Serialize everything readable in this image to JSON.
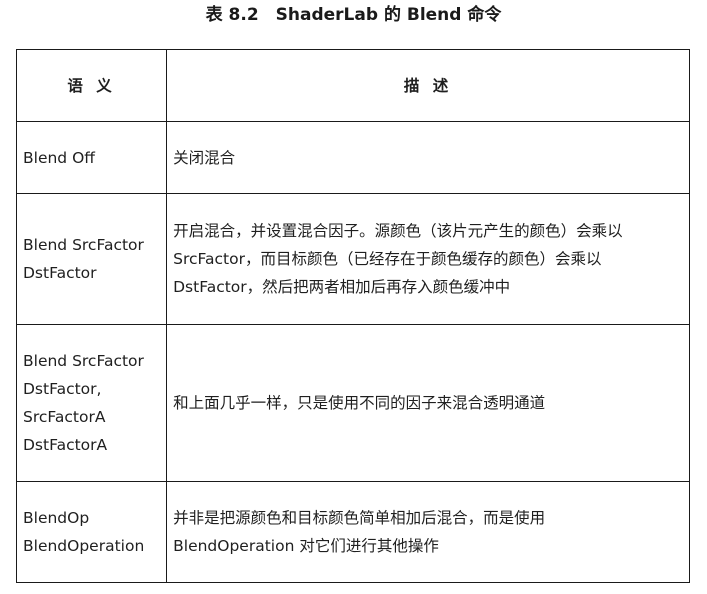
{
  "caption": "表 8.2　ShaderLab 的 Blend 命令",
  "table": {
    "headers": [
      "语 义",
      "描 述"
    ],
    "rows": [
      {
        "semantic": [
          "Blend Off"
        ],
        "description": [
          "关闭混合"
        ]
      },
      {
        "semantic": [
          "Blend SrcFactor",
          "DstFactor"
        ],
        "description": [
          "开启混合，并设置混合因子。源颜色（该片元产生的颜色）会乘以",
          "SrcFactor，而目标颜色（已经存在于颜色缓存的颜色）会乘以",
          "DstFactor，然后把两者相加后再存入颜色缓冲中"
        ]
      },
      {
        "semantic": [
          "Blend SrcFactor",
          "DstFactor,",
          "SrcFactorA",
          "DstFactorA"
        ],
        "description": [
          "和上面几乎一样，只是使用不同的因子来混合透明通道"
        ]
      },
      {
        "semantic": [
          "BlendOp",
          "BlendOperation"
        ],
        "description": [
          "并非是把源颜色和目标颜色简单相加后混合，而是使用",
          "BlendOperation 对它们进行其他操作"
        ]
      }
    ]
  }
}
